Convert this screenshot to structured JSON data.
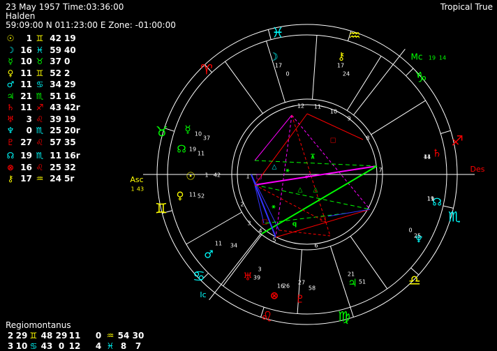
{
  "header": {
    "line1": "23 May 1957 Time:03:36:00",
    "line2": "Halden",
    "line3": "59:09:00 N 011:23:00 E Zone: -01:00:00",
    "system": "Tropical True"
  },
  "colors": {
    "yellow": "#ffff00",
    "cyan": "#00ffff",
    "green": "#00ff00",
    "red": "#ff0000",
    "magenta": "#ff00ff",
    "blue": "#3333ff",
    "white": "#ffffff"
  },
  "planets": [
    {
      "glyph": "☉",
      "glyph_icon": "sun-icon",
      "color": "#ffff00",
      "deg": "1",
      "sign": "♊",
      "sign_icon": "gemini-icon",
      "min": "42",
      "extra": "19"
    },
    {
      "glyph": "☽",
      "glyph_icon": "moon-icon",
      "color": "#00ffff",
      "deg": "16",
      "sign": "♓",
      "sign_icon": "pisces-icon",
      "min": "59",
      "extra": "40"
    },
    {
      "glyph": "☿",
      "glyph_icon": "mercury-icon",
      "color": "#00ff00",
      "deg": "10",
      "sign": "♉",
      "sign_icon": "taurus-icon",
      "min": "37",
      "extra": "0"
    },
    {
      "glyph": "♀",
      "glyph_icon": "venus-icon",
      "color": "#ffff00",
      "deg": "11",
      "sign": "♊",
      "sign_icon": "gemini-icon",
      "min": "52",
      "extra": "2"
    },
    {
      "glyph": "♂",
      "glyph_icon": "mars-icon",
      "color": "#00ffff",
      "deg": "11",
      "sign": "♋",
      "sign_icon": "cancer-icon",
      "min": "34",
      "extra": "29"
    },
    {
      "glyph": "♃",
      "glyph_icon": "jupiter-icon",
      "color": "#00ff00",
      "deg": "21",
      "sign": "♏",
      "sign_icon": "scorpio-icon",
      "min": "51",
      "extra": "16"
    },
    {
      "glyph": "♄",
      "glyph_icon": "saturn-icon",
      "color": "#ff0000",
      "deg": "11",
      "sign": "♐",
      "sign_icon": "sagittarius-icon",
      "min": "43",
      "extra": "42r"
    },
    {
      "glyph": "♅",
      "glyph_icon": "uranus-icon",
      "color": "#ff0000",
      "deg": "3",
      "sign": "♌",
      "sign_icon": "leo-icon",
      "min": "39",
      "extra": "19"
    },
    {
      "glyph": "♆",
      "glyph_icon": "neptune-icon",
      "color": "#00ffff",
      "deg": "0",
      "sign": "♏",
      "sign_icon": "scorpio-icon",
      "min": "25",
      "extra": "20r"
    },
    {
      "glyph": "♇",
      "glyph_icon": "pluto-icon",
      "color": "#ff0000",
      "deg": "27",
      "sign": "♌",
      "sign_icon": "leo-icon",
      "min": "57",
      "extra": "35"
    },
    {
      "glyph": "☊",
      "glyph_icon": "node-icon",
      "color": "#00ffff",
      "deg": "19",
      "sign": "♏",
      "sign_icon": "scorpio-icon",
      "min": "11",
      "extra": "16r",
      "gap": true
    },
    {
      "glyph": "⊗",
      "glyph_icon": "fortune-icon",
      "color": "#ff0000",
      "deg": "16",
      "sign": "♌",
      "sign_icon": "leo-icon",
      "min": "25",
      "extra": "32"
    },
    {
      "glyph": "⚷",
      "glyph_icon": "chiron-icon",
      "color": "#ffff00",
      "deg": "17",
      "sign": "♒",
      "sign_icon": "aquarius-icon",
      "min": "24",
      "extra": "5r"
    }
  ],
  "house_system": "Regiomontanus",
  "houses_row1": [
    {
      "a": "2",
      "b": "29",
      "sign": "♊",
      "sign_icon": "gemini-icon",
      "color": "#ffff00",
      "c": "48"
    },
    {
      "a": "29",
      "b": "11",
      "sign": "",
      "sign_icon": "",
      "color": "#ffffff",
      "c": ""
    },
    {
      "a": "0",
      "b": "",
      "sign": "♒",
      "sign_icon": "aquarius-icon",
      "color": "#ffff00",
      "c": "54"
    },
    {
      "a": "30",
      "b": "",
      "sign": "",
      "sign_icon": "",
      "color": "#ffffff",
      "c": ""
    }
  ],
  "houses_row2": [
    {
      "a": "3",
      "b": "10",
      "sign": "♋",
      "sign_icon": "cancer-icon",
      "color": "#00ffff",
      "c": "43"
    },
    {
      "a": "0",
      "b": "12",
      "sign": "",
      "sign_icon": "",
      "color": "#ffffff",
      "c": ""
    },
    {
      "a": "4",
      "b": "",
      "sign": "♓",
      "sign_icon": "pisces-icon",
      "color": "#00ffff",
      "c": "8"
    },
    {
      "a": "7",
      "b": "",
      "sign": "",
      "sign_icon": "",
      "color": "#ffffff",
      "c": ""
    }
  ],
  "angles": {
    "asc": "Asc",
    "asc_deg": "1",
    "asc_min": "43",
    "mc": "Mc",
    "mc_deg": "19",
    "mc_min": "14",
    "des": "Des",
    "ic": "Ic"
  },
  "house_numbers": [
    "1",
    "2",
    "3",
    "4",
    "5",
    "6",
    "7",
    "8",
    "9",
    "10",
    "11",
    "12"
  ],
  "wheel_signs": [
    {
      "glyph": "♓",
      "icon": "pisces-icon",
      "color": "#00ffff"
    },
    {
      "glyph": "♒",
      "icon": "aquarius-icon",
      "color": "#ffff00"
    },
    {
      "glyph": "♑",
      "icon": "capricorn-icon",
      "color": "#00ff00"
    },
    {
      "glyph": "♐",
      "icon": "sagittarius-icon",
      "color": "#ff0000"
    },
    {
      "glyph": "♏",
      "icon": "scorpio-icon",
      "color": "#00ffff"
    },
    {
      "glyph": "♎",
      "icon": "libra-icon",
      "color": "#ffff00"
    },
    {
      "glyph": "♍",
      "icon": "virgo-icon",
      "color": "#00ff00"
    },
    {
      "glyph": "♌",
      "icon": "leo-icon",
      "color": "#ff0000"
    },
    {
      "glyph": "♋",
      "icon": "cancer-icon",
      "color": "#00ffff"
    },
    {
      "glyph": "♊",
      "icon": "gemini-icon",
      "color": "#ffff00"
    },
    {
      "glyph": "♉",
      "icon": "taurus-icon",
      "color": "#00ff00"
    },
    {
      "glyph": "♈",
      "icon": "aries-icon",
      "color": "#ff0000"
    }
  ],
  "wheel_planets": [
    {
      "id": "moon",
      "glyph": "☽",
      "color": "#00ffff",
      "deg": "17",
      "min": "0"
    },
    {
      "id": "chiron",
      "glyph": "⚷",
      "color": "#ffff00",
      "deg": "17",
      "min": "24"
    },
    {
      "id": "mercury",
      "glyph": "☿",
      "color": "#00ff00",
      "deg": "10",
      "min": "37"
    },
    {
      "id": "node",
      "glyph": "☊",
      "color": "#00ff00",
      "deg": "19",
      "min": "11"
    },
    {
      "id": "sun",
      "glyph": "☉",
      "color": "#ffff00",
      "deg": "1",
      "min": "42"
    },
    {
      "id": "venus",
      "glyph": "♀",
      "color": "#ffff00",
      "deg": "11",
      "min": "52"
    },
    {
      "id": "mars",
      "glyph": "♂",
      "color": "#00ffff",
      "deg": "11",
      "min": "34"
    },
    {
      "id": "uranus",
      "glyph": "♅",
      "color": "#ff0000",
      "deg": "3",
      "min": "39"
    },
    {
      "id": "fortune",
      "glyph": "⊗",
      "color": "#ff0000",
      "deg": "16",
      "min": "26"
    },
    {
      "id": "pluto",
      "glyph": "♇",
      "color": "#ff0000",
      "deg": "27",
      "min": "58"
    },
    {
      "id": "jupiter",
      "glyph": "♃",
      "color": "#00ff00",
      "deg": "21",
      "min": "51"
    },
    {
      "id": "neptune",
      "glyph": "♆",
      "color": "#00ffff",
      "deg": "0",
      "min": "25"
    },
    {
      "id": "northnode",
      "glyph": "☊",
      "color": "#00ffff",
      "deg": "11",
      "min": "19"
    },
    {
      "id": "saturn",
      "glyph": "♄",
      "color": "#ff0000",
      "deg": "11",
      "min": "44"
    }
  ],
  "aspect_glyphs": [
    "□",
    "△",
    "⚹",
    "☍",
    "⊼",
    "□",
    "△",
    "△",
    "⚹",
    "□",
    "q",
    "□"
  ]
}
